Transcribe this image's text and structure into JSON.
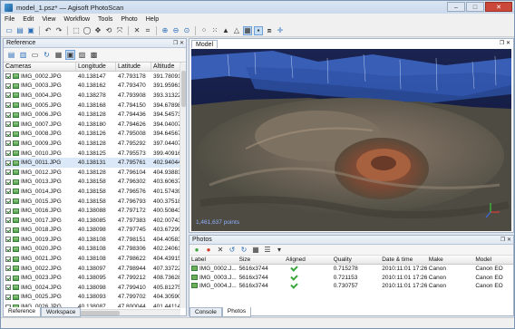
{
  "window": {
    "title": "model_1.psz* — Agisoft PhotoScan",
    "min": "–",
    "max": "□",
    "close": "✕"
  },
  "menu": [
    "File",
    "Edit",
    "View",
    "Workflow",
    "Tools",
    "Photo",
    "Help"
  ],
  "reference": {
    "title": "Reference",
    "columns": [
      "Cameras",
      "Longitude",
      "Latitude",
      "Altitude"
    ],
    "rows": [
      [
        "IMG_0002.JPG",
        "40.138147",
        "47.793178",
        "391.780913"
      ],
      [
        "IMG_0003.JPG",
        "40.138162",
        "47.793470",
        "391.959612"
      ],
      [
        "IMG_0004.JPG",
        "40.138278",
        "47.793908",
        "393.313226"
      ],
      [
        "IMG_0005.JPG",
        "40.138168",
        "47.794150",
        "394.678983"
      ],
      [
        "IMG_0006.JPG",
        "40.138128",
        "47.794436",
        "394.545738"
      ],
      [
        "IMG_0007.JPG",
        "40.138180",
        "47.794626",
        "394.040071"
      ],
      [
        "IMG_0008.JPG",
        "40.138126",
        "47.795008",
        "394.645672"
      ],
      [
        "IMG_0009.JPG",
        "40.138128",
        "47.795292",
        "397.044074"
      ],
      [
        "IMG_0010.JPG",
        "40.138125",
        "47.795573",
        "399.409166"
      ],
      [
        "IMG_0011.JPG",
        "40.138131",
        "47.795761",
        "402.940445"
      ],
      [
        "IMG_0012.JPG",
        "40.138128",
        "47.796104",
        "404.938817"
      ],
      [
        "IMG_0013.JPG",
        "40.138158",
        "47.796302",
        "403.606371"
      ],
      [
        "IMG_0014.JPG",
        "40.138158",
        "47.796576",
        "401.574391"
      ],
      [
        "IMG_0015.JPG",
        "40.138158",
        "47.796793",
        "400.375189"
      ],
      [
        "IMG_0016.JPG",
        "40.138088",
        "47.797172",
        "400.508434"
      ],
      [
        "IMG_0017.JPG",
        "40.138085",
        "47.797383",
        "402.007436"
      ],
      [
        "IMG_0018.JPG",
        "40.138098",
        "47.797745",
        "403.672993"
      ],
      [
        "IMG_0019.JPG",
        "40.138108",
        "47.798151",
        "404.405838"
      ],
      [
        "IMG_0020.JPG",
        "40.138108",
        "47.798306",
        "402.240614"
      ],
      [
        "IMG_0021.JPG",
        "40.138108",
        "47.798622",
        "404.439150"
      ],
      [
        "IMG_0022.JPG",
        "40.138097",
        "47.798944",
        "407.337220"
      ],
      [
        "IMG_0023.JPG",
        "40.138095",
        "47.799212",
        "408.736288"
      ],
      [
        "IMG_0024.JPG",
        "40.138098",
        "47.799410",
        "405.812758"
      ],
      [
        "IMG_0025.JPG",
        "40.138093",
        "47.799702",
        "404.305905"
      ],
      [
        "IMG_0026.JPG",
        "40.138087",
        "47.800044",
        "401.441146"
      ]
    ]
  },
  "model": {
    "tab": "Model",
    "points": "1,461,637 points"
  },
  "photos": {
    "title": "Photos",
    "columns": [
      "Label",
      "Size",
      "Aligned",
      "Quality",
      "Date & time",
      "Make",
      "Model"
    ],
    "rows": [
      [
        "IMG_0002.J...",
        "5616x3744",
        "0.715278",
        "2010:11:01 17:26...",
        "Canon",
        "Canon EO"
      ],
      [
        "IMG_0003.J...",
        "5616x3744",
        "0.721153",
        "2010:11:01 17:26...",
        "Canon",
        "Canon EO"
      ],
      [
        "IMG_0004.J...",
        "5616x3744",
        "0.730757",
        "2010:11:01 17:26...",
        "Canon",
        "Canon EO"
      ]
    ]
  },
  "tabs_left": [
    "Reference",
    "Workspace"
  ],
  "tabs_bottom": [
    "Console",
    "Photos"
  ]
}
